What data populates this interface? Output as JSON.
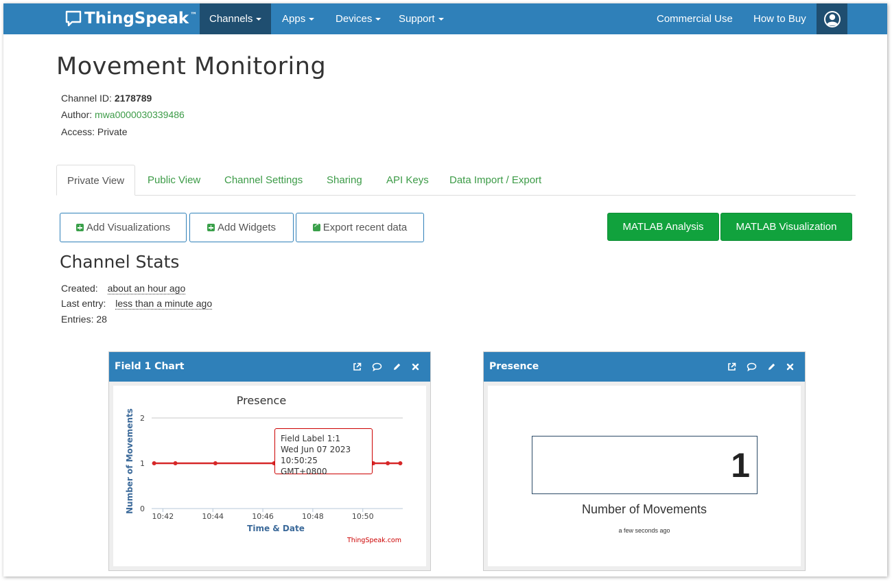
{
  "nav": {
    "brand": "ThingSpeak",
    "brand_tm": "™",
    "channels": "Channels",
    "apps": "Apps",
    "devices": "Devices",
    "support": "Support",
    "commercial": "Commercial Use",
    "how_to_buy": "How to Buy"
  },
  "channel": {
    "title": "Movement Monitoring",
    "id_label": "Channel ID:",
    "id_value": "2178789",
    "author_label": "Author:",
    "author_value": "mwa0000030339486",
    "access_label": "Access:",
    "access_value": "Private"
  },
  "tabs": [
    {
      "label": "Private View"
    },
    {
      "label": "Public View"
    },
    {
      "label": "Channel Settings"
    },
    {
      "label": "Sharing"
    },
    {
      "label": "API Keys"
    },
    {
      "label": "Data Import / Export"
    }
  ],
  "buttons": {
    "add_visualizations": "Add Visualizations",
    "add_widgets": "Add Widgets",
    "export_recent": "Export recent data",
    "matlab_analysis": "MATLAB Analysis",
    "matlab_visualization": "MATLAB Visualization"
  },
  "stats": {
    "title": "Channel Stats",
    "created_label": "Created:",
    "created_value": "about an hour ago",
    "last_label": "Last entry:",
    "last_value": "less than a minute ago",
    "entries_label": "Entries:",
    "entries_value": "28"
  },
  "panel1": {
    "title": "Field 1 Chart"
  },
  "panel2": {
    "title": "Presence",
    "value": "1",
    "label": "Number of Movements",
    "time": "a few seconds ago"
  },
  "tooltip": {
    "line1": "Field Label 1:1",
    "line2": "Wed Jun 07 2023",
    "line3": "10:50:25 GMT+0800"
  },
  "colors": {
    "nav": "#2f80b9",
    "nav_active": "#1f4e70",
    "link_green": "#3c9b47",
    "button_green": "#11a23d",
    "series": "#d62728"
  },
  "chart_data": {
    "type": "line",
    "title": "Presence",
    "xlabel": "Time & Date",
    "ylabel": "Number of Movements",
    "credit": "ThingSpeak.com",
    "x_ticks": [
      "10:42",
      "10:44",
      "10:46",
      "10:48",
      "10:50"
    ],
    "x_tick_minutes": [
      42,
      44,
      46,
      48,
      50
    ],
    "x_range_minutes": [
      41.55,
      51.6
    ],
    "y_ticks": [
      0,
      1,
      2
    ],
    "ylim": [
      0,
      2
    ],
    "series": [
      {
        "color": "#d62728",
        "points": [
          {
            "minute": 41.65,
            "value": 1
          },
          {
            "minute": 42.5,
            "value": 1
          },
          {
            "minute": 44.1,
            "value": 1
          },
          {
            "minute": 46.45,
            "value": 1
          },
          {
            "minute": 50.42,
            "value": 1
          },
          {
            "minute": 51.0,
            "value": 1
          },
          {
            "minute": 51.5,
            "value": 1
          }
        ]
      }
    ]
  }
}
